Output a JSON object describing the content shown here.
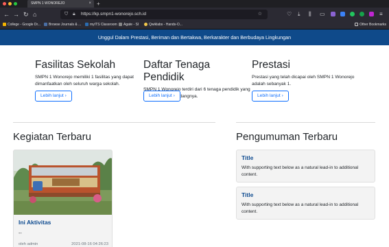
{
  "browser": {
    "tab_title": "SMPN 1 WONOREJO",
    "tab_close": "×",
    "new_tab": "+",
    "url": "https://kp.smpn1-wonorejo.sch.id",
    "bookmarks": [
      {
        "label": "College - Google Dr...",
        "color": "#f4b400"
      },
      {
        "label": "Browse Journals & ...",
        "color": "#4a6fa5"
      },
      {
        "label": "myITS Classroom",
        "color": "#2b6cb0"
      },
      {
        "label": "Agate - SI",
        "color": "#888888"
      },
      {
        "label": "Qwiklabs - Hands-O...",
        "color": "#f2c94c"
      }
    ],
    "other_bookmarks": "Other Bookmarks"
  },
  "banner": {
    "text": "Unggul Dalam Prestasi, Beriman dan Bertakwa, Berkarakter dan Berbudaya Lingkungan",
    "color": "#0f4a8a"
  },
  "features": [
    {
      "title": "Fasilitas Sekolah",
      "text": "SMPN 1 Wonorejo memiliki 1 fasilitas yang dapat dimanfaatkan oleh seluruh warga sekolah.",
      "button": "Lebih lanjut"
    },
    {
      "title": "Daftar Tenaga Pendidik",
      "text": "SMPN 1 Wonorejo terdiri dari 6 tenaga pendidik yang berkompeten di bidangnya.",
      "button": "Lebih lanjut"
    },
    {
      "title": "Prestasi",
      "text": "Prestasi yang telah dicapai oleh SMPN 1 Wonorejo adalah sebanyak 1.",
      "button": "Lebih lanjut"
    }
  ],
  "activities": {
    "heading": "Kegiatan Terbaru",
    "items": [
      {
        "title": "Ini Aktivitas",
        "text": "--",
        "author": "oleh admin",
        "date": "2021-08-16 04:26:23"
      }
    ]
  },
  "announcements": {
    "heading": "Pengumuman Terbaru",
    "items": [
      {
        "title": "Title",
        "text": "With supporting text below as a natural lead-in to additional content."
      },
      {
        "title": "Title",
        "text": "With supporting text below as a natural lead-in to additional content."
      }
    ]
  },
  "colors": {
    "accent": "#0d6efd",
    "link_title": "#0d4a8f"
  }
}
